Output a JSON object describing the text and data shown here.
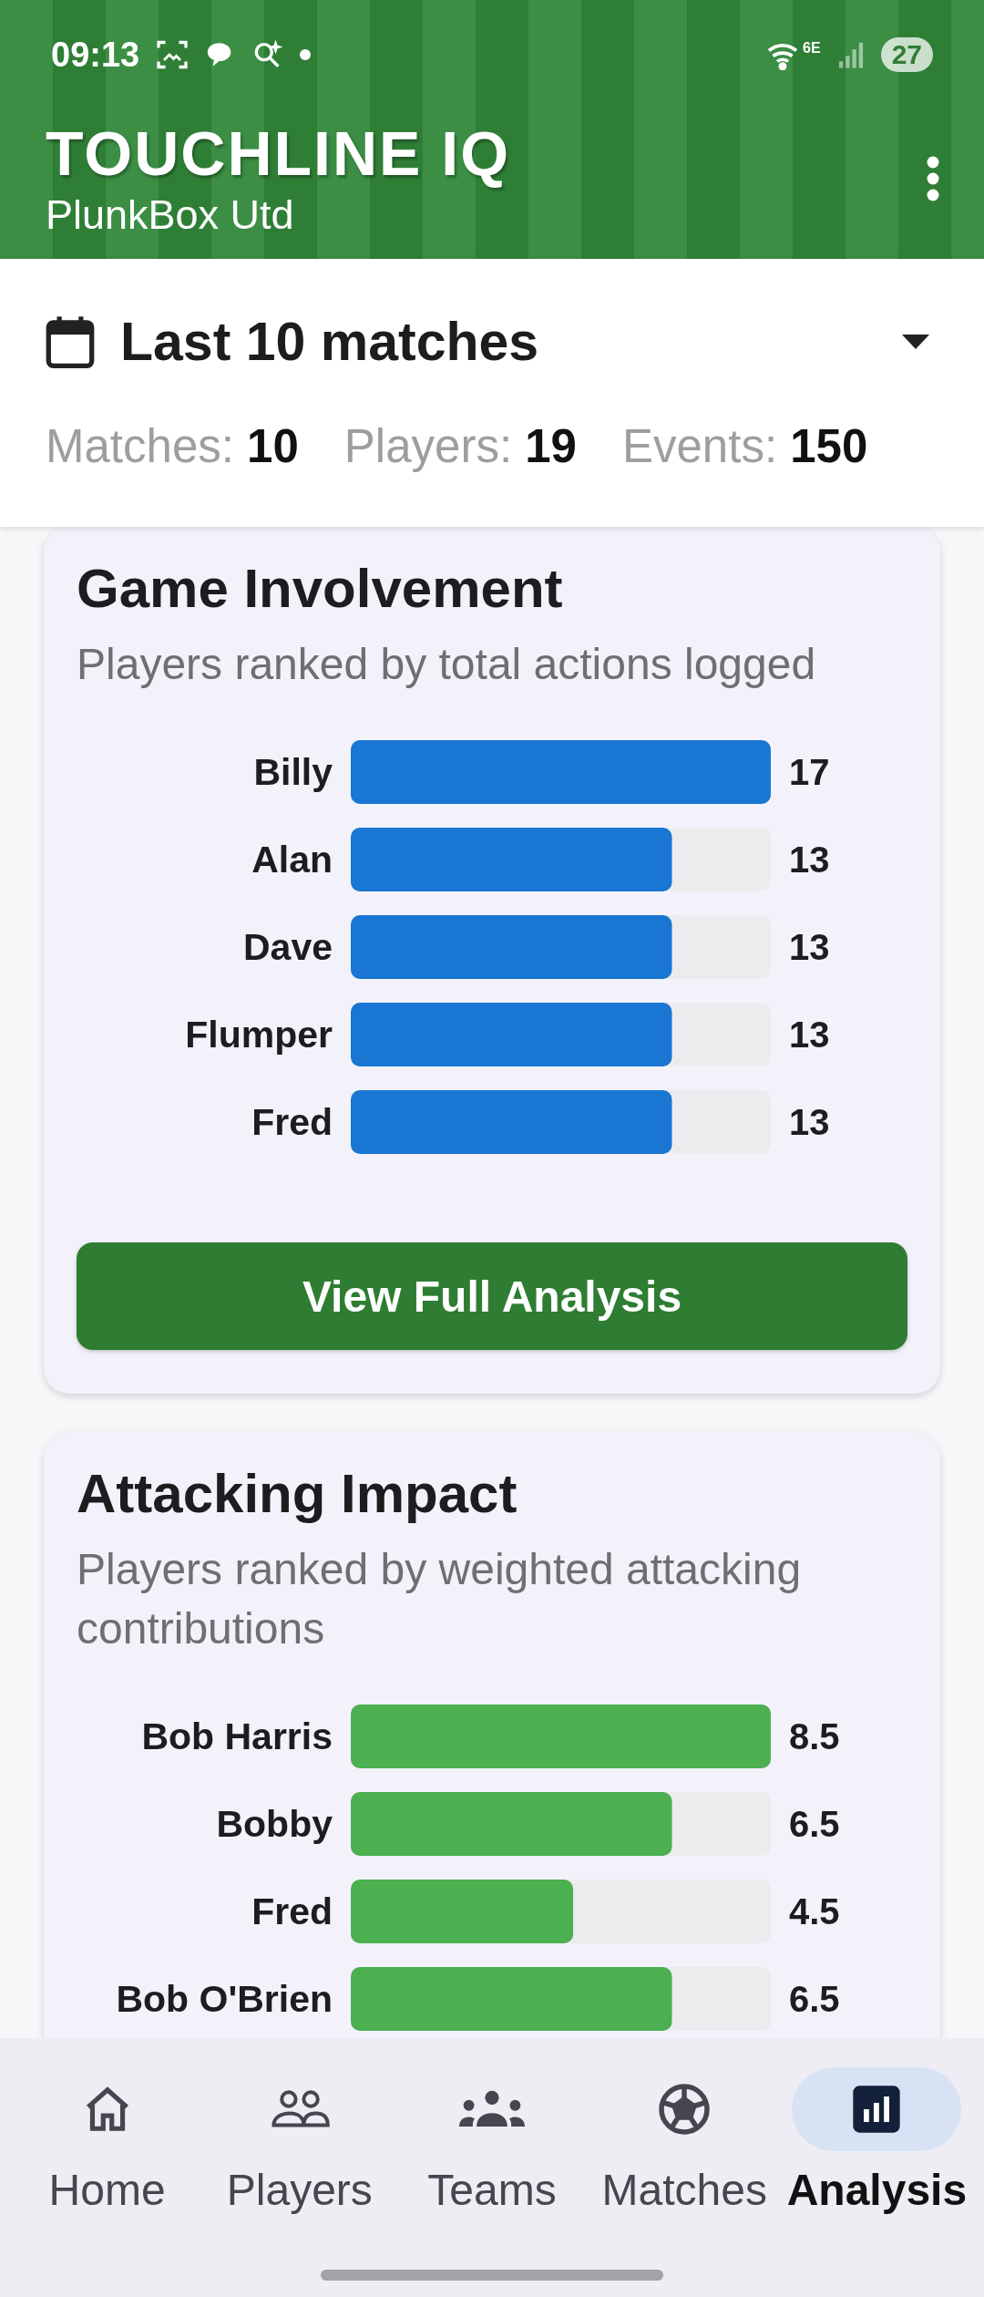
{
  "status_bar": {
    "time": "09:13",
    "network_label": "6E",
    "battery": "27"
  },
  "app_bar": {
    "title": "TOUCHLINE IQ",
    "subtitle": "PlunkBox Utd"
  },
  "filter": {
    "period": "Last 10 matches",
    "stats": [
      {
        "label": "Matches:",
        "value": "10"
      },
      {
        "label": "Players:",
        "value": "19"
      },
      {
        "label": "Events:",
        "value": "150"
      }
    ]
  },
  "cards": [
    {
      "title": "Game Involvement",
      "subtitle": "Players ranked by total actions logged",
      "chart_data": {
        "type": "bar",
        "orientation": "horizontal",
        "categories": [
          "Billy",
          "Alan",
          "Dave",
          "Flumper",
          "Fred"
        ],
        "series": [
          {
            "color": "#1976d2",
            "values": [
              17,
              13,
              13,
              13,
              13
            ]
          }
        ],
        "data_labels": true
      },
      "button": "View Full Analysis"
    },
    {
      "title": "Attacking Impact",
      "subtitle": "Players ranked by weighted attacking contributions",
      "chart_data": {
        "type": "bar",
        "orientation": "horizontal",
        "categories": [
          "Bob Harris",
          "Bobby",
          "Fred",
          "Bob O'Brien"
        ],
        "series": [
          {
            "color": "#4caf50",
            "values": [
              8.5,
              6.5,
              4.5,
              6.5
            ]
          }
        ],
        "data_labels": true
      }
    }
  ],
  "nav": [
    {
      "label": "Home",
      "selected": false
    },
    {
      "label": "Players",
      "selected": false
    },
    {
      "label": "Teams",
      "selected": false
    },
    {
      "label": "Matches",
      "selected": false
    },
    {
      "label": "Analysis",
      "selected": true
    }
  ]
}
